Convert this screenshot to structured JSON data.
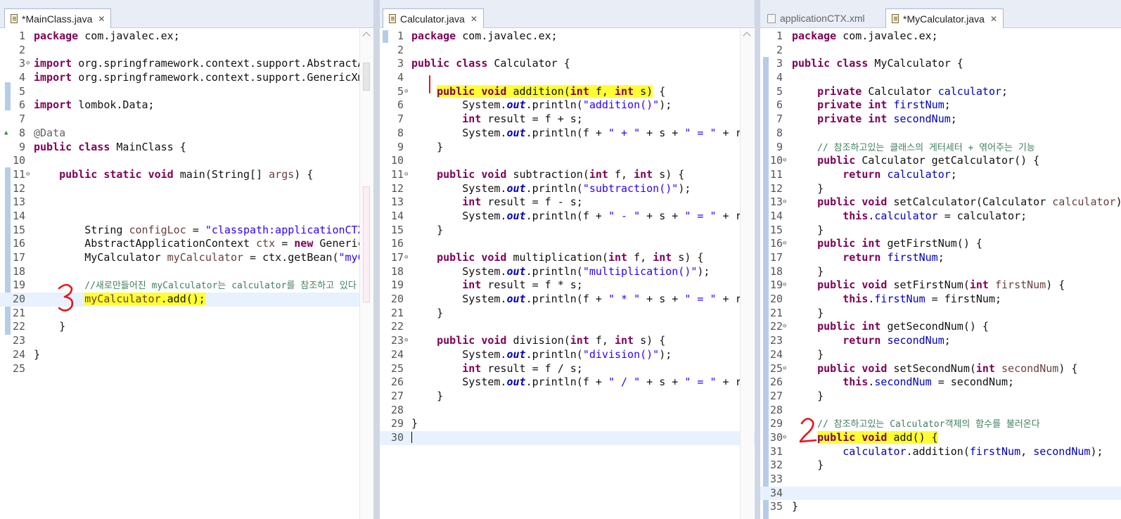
{
  "panes": [
    {
      "id": "main",
      "tabs": [
        {
          "label": "*MainClass.java",
          "active": true,
          "icon": "java-file-icon"
        }
      ],
      "lines": [
        {
          "n": "1",
          "html": "<span class=\"kw\">package</span> com.javalec.ex;"
        },
        {
          "n": "2",
          "html": ""
        },
        {
          "n": "3",
          "fold": true,
          "html": "<span class=\"kw\">import</span> org.springframework.context.support.AbstractApplicationContext;"
        },
        {
          "n": "4",
          "html": "<span class=\"kw\">import</span> org.springframework.context.support.GenericXmlApplicationContext;"
        },
        {
          "n": "5",
          "html": ""
        },
        {
          "n": "6",
          "html": "<span class=\"kw\">import</span> lombok.Data;"
        },
        {
          "n": "7",
          "html": ""
        },
        {
          "n": "8",
          "marker": "override",
          "html": "<span class=\"ann\">@Data</span>"
        },
        {
          "n": "9",
          "html": "<span class=\"kw\">public</span> <span class=\"kw\">class</span> MainClass {"
        },
        {
          "n": "10",
          "html": ""
        },
        {
          "n": "11",
          "fold": true,
          "html": "    <span class=\"kw\">public</span> <span class=\"kw\">static</span> <span class=\"kw\">void</span> main(String[] <span class=\"var\">args</span>) {"
        },
        {
          "n": "12",
          "html": ""
        },
        {
          "n": "13",
          "html": ""
        },
        {
          "n": "14",
          "html": ""
        },
        {
          "n": "15",
          "html": "        String <span class=\"var\">configLoc</span> = <span class=\"str\">\"classpath:applicationCTX.xml\"</span>;"
        },
        {
          "n": "16",
          "html": "        AbstractApplicationContext <span class=\"var\">ctx</span> = <span class=\"kw\">new</span> GenericXmlApplicationContext(<span class=\"var\">configLoc</span>);"
        },
        {
          "n": "17",
          "html": "        MyCalculator <span class=\"var\">myCalculator</span> = ctx.getBean(<span class=\"str\">\"myCalculator\"</span>, MyCalculator.<span class=\"kw\">class</span>);"
        },
        {
          "n": "18",
          "html": ""
        },
        {
          "n": "19",
          "html": "        <span class=\"cmt\">//새로만들어진 myCalculator는 calculator를 참조하고 있다</span>"
        },
        {
          "n": "20",
          "current": true,
          "html": "        <span class=\"hl\"><span class=\"var\">myCalculator</span>.add();</span>"
        },
        {
          "n": "21",
          "html": ""
        },
        {
          "n": "22",
          "html": "    }"
        },
        {
          "n": "23",
          "html": ""
        },
        {
          "n": "24",
          "html": "}"
        },
        {
          "n": "25",
          "html": ""
        }
      ]
    },
    {
      "id": "calc",
      "tabs": [
        {
          "label": "Calculator.java",
          "active": true,
          "icon": "java-file-icon"
        }
      ],
      "lines": [
        {
          "n": "1",
          "html": "<span class=\"kw\">package</span> com.javalec.ex;"
        },
        {
          "n": "2",
          "html": ""
        },
        {
          "n": "3",
          "html": "<span class=\"kw\">public</span> <span class=\"kw\">class</span> Calculator {"
        },
        {
          "n": "4",
          "html": ""
        },
        {
          "n": "5",
          "fold": true,
          "html": "    <span class=\"hl\"><span class=\"kw\">public</span> <span class=\"kw\">void</span> addition(<span class=\"kw\">int</span> f, <span class=\"kw\">int</span> s)</span> {"
        },
        {
          "n": "6",
          "html": "        System.<span class=\"sfld\">out</span>.println(<span class=\"str\">\"addition()\"</span>);"
        },
        {
          "n": "7",
          "html": "        <span class=\"kw\">int</span> result = f + s;"
        },
        {
          "n": "8",
          "html": "        System.<span class=\"sfld\">out</span>.println(f + <span class=\"str\">\" + \"</span> + s + <span class=\"str\">\" = \"</span> + result);"
        },
        {
          "n": "9",
          "html": "    }"
        },
        {
          "n": "10",
          "html": ""
        },
        {
          "n": "11",
          "fold": true,
          "html": "    <span class=\"kw\">public</span> <span class=\"kw\">void</span> subtraction(<span class=\"kw\">int</span> f, <span class=\"kw\">int</span> s) {"
        },
        {
          "n": "12",
          "html": "        System.<span class=\"sfld\">out</span>.println(<span class=\"str\">\"subtraction()\"</span>);"
        },
        {
          "n": "13",
          "html": "        <span class=\"kw\">int</span> result = f - s;"
        },
        {
          "n": "14",
          "html": "        System.<span class=\"sfld\">out</span>.println(f + <span class=\"str\">\" - \"</span> + s + <span class=\"str\">\" = \"</span> + result);"
        },
        {
          "n": "15",
          "html": "    }"
        },
        {
          "n": "16",
          "html": ""
        },
        {
          "n": "17",
          "fold": true,
          "html": "    <span class=\"kw\">public</span> <span class=\"kw\">void</span> multiplication(<span class=\"kw\">int</span> f, <span class=\"kw\">int</span> s) {"
        },
        {
          "n": "18",
          "html": "        System.<span class=\"sfld\">out</span>.println(<span class=\"str\">\"multiplication()\"</span>);"
        },
        {
          "n": "19",
          "html": "        <span class=\"kw\">int</span> result = f * s;"
        },
        {
          "n": "20",
          "html": "        System.<span class=\"sfld\">out</span>.println(f + <span class=\"str\">\" * \"</span> + s + <span class=\"str\">\" = \"</span> + result);"
        },
        {
          "n": "21",
          "html": "    }"
        },
        {
          "n": "22",
          "html": ""
        },
        {
          "n": "23",
          "fold": true,
          "html": "    <span class=\"kw\">public</span> <span class=\"kw\">void</span> division(<span class=\"kw\">int</span> f, <span class=\"kw\">int</span> s) {"
        },
        {
          "n": "24",
          "html": "        System.<span class=\"sfld\">out</span>.println(<span class=\"str\">\"division()\"</span>);"
        },
        {
          "n": "25",
          "html": "        <span class=\"kw\">int</span> result = f / s;"
        },
        {
          "n": "26",
          "html": "        System.<span class=\"sfld\">out</span>.println(f + <span class=\"str\">\" / \"</span> + s + <span class=\"str\">\" = \"</span> + result);"
        },
        {
          "n": "27",
          "html": "    }"
        },
        {
          "n": "28",
          "html": ""
        },
        {
          "n": "29",
          "html": "}"
        },
        {
          "n": "30",
          "current": true,
          "cursor": true,
          "html": ""
        }
      ]
    },
    {
      "id": "mycalc",
      "tabs": [
        {
          "label": "applicationCTX.xml",
          "active": false,
          "icon": "xml-file-icon"
        },
        {
          "label": "*MyCalculator.java",
          "active": true,
          "icon": "java-file-icon"
        }
      ],
      "lines": [
        {
          "n": "1",
          "html": "<span class=\"kw\">package</span> com.javalec.ex;"
        },
        {
          "n": "2",
          "html": ""
        },
        {
          "n": "3",
          "html": "<span class=\"kw\">public</span> <span class=\"kw\">class</span> MyCalculator {"
        },
        {
          "n": "4",
          "html": ""
        },
        {
          "n": "5",
          "html": "    <span class=\"kw\">private</span> Calculator <span class=\"fld\">calculator</span>;"
        },
        {
          "n": "6",
          "html": "    <span class=\"kw\">private</span> <span class=\"kw\">int</span> <span class=\"fld\">firstNum</span>;"
        },
        {
          "n": "7",
          "html": "    <span class=\"kw\">private</span> <span class=\"kw\">int</span> <span class=\"fld\">secondNum</span>;"
        },
        {
          "n": "8",
          "html": ""
        },
        {
          "n": "9",
          "html": "    <span class=\"cmt\">// 참조하고있는 클래스의 게터세터 + 엮어주는 기능</span>"
        },
        {
          "n": "10",
          "fold": true,
          "html": "    <span class=\"kw\">public</span> Calculator getCalculator() {"
        },
        {
          "n": "11",
          "html": "        <span class=\"kw\">return</span> <span class=\"fld\">calculator</span>;"
        },
        {
          "n": "12",
          "html": "    }"
        },
        {
          "n": "13",
          "fold": true,
          "html": "    <span class=\"kw\">public</span> <span class=\"kw\">void</span> setCalculator(Calculator <span class=\"var\">calculator</span>) {"
        },
        {
          "n": "14",
          "html": "        <span class=\"kw\">this</span>.<span class=\"fld\">calculator</span> = calculator;"
        },
        {
          "n": "15",
          "html": "    }"
        },
        {
          "n": "16",
          "fold": true,
          "html": "    <span class=\"kw\">public</span> <span class=\"kw\">int</span> getFirstNum() {"
        },
        {
          "n": "17",
          "html": "        <span class=\"kw\">return</span> <span class=\"fld\">firstNum</span>;"
        },
        {
          "n": "18",
          "html": "    }"
        },
        {
          "n": "19",
          "fold": true,
          "html": "    <span class=\"kw\">public</span> <span class=\"kw\">void</span> setFirstNum(<span class=\"kw\">int</span> <span class=\"var\">firstNum</span>) {"
        },
        {
          "n": "20",
          "html": "        <span class=\"kw\">this</span>.<span class=\"fld\">firstNum</span> = firstNum;"
        },
        {
          "n": "21",
          "html": "    }"
        },
        {
          "n": "22",
          "fold": true,
          "html": "    <span class=\"kw\">public</span> <span class=\"kw\">int</span> getSecondNum() {"
        },
        {
          "n": "23",
          "html": "        <span class=\"kw\">return</span> <span class=\"fld\">secondNum</span>;"
        },
        {
          "n": "24",
          "html": "    }"
        },
        {
          "n": "25",
          "fold": true,
          "html": "    <span class=\"kw\">public</span> <span class=\"kw\">void</span> setSecondNum(<span class=\"kw\">int</span> <span class=\"var\">secondNum</span>) {"
        },
        {
          "n": "26",
          "html": "        <span class=\"kw\">this</span>.<span class=\"fld\">secondNum</span> = secondNum;"
        },
        {
          "n": "27",
          "html": "    }"
        },
        {
          "n": "28",
          "html": ""
        },
        {
          "n": "29",
          "html": "    <span class=\"cmt\">// 참조하고있는 Calculator객체의 함수를 불러온다</span>"
        },
        {
          "n": "30",
          "fold": true,
          "html": "    <span class=\"hl\"><span class=\"kw\">public</span> <span class=\"kw\">void</span> add() {</span>"
        },
        {
          "n": "31",
          "html": "        <span class=\"fld\">calculator</span>.addition(<span class=\"fld\">firstNum</span>, <span class=\"fld\">secondNum</span>);"
        },
        {
          "n": "32",
          "html": "    }"
        },
        {
          "n": "33",
          "html": ""
        },
        {
          "n": "34",
          "current": true,
          "html": ""
        },
        {
          "n": "35",
          "html": "}"
        }
      ]
    }
  ],
  "annotations": [
    {
      "label": "1",
      "color": "#e8141b"
    },
    {
      "label": "2",
      "color": "#e8141b"
    },
    {
      "label": "3",
      "color": "#e8141b"
    }
  ],
  "colors": {
    "keyword": "#7f0055",
    "string": "#2a00ff",
    "field": "#0000c0",
    "comment": "#3f7f5f",
    "highlight": "#ffff33",
    "current_line": "#e8f2fe",
    "change_bar": "#b7cce8"
  }
}
